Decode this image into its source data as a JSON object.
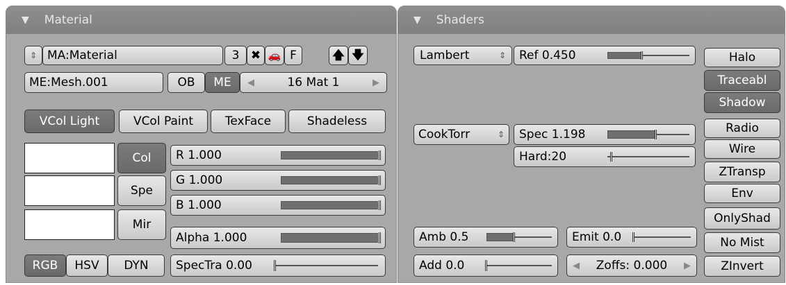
{
  "material_panel": {
    "title": "Material",
    "material_name": "MA:Material",
    "user_count": "3",
    "f_label": "F",
    "mesh_name": "ME:Mesh.001",
    "ob_label": "OB",
    "me_label": "ME",
    "mat_index": "16 Mat 1",
    "toggles": [
      "VCol Light",
      "VCol Paint",
      "TexFace",
      "Shadeless"
    ],
    "color_buttons": [
      "Col",
      "Spe",
      "Mir"
    ],
    "sliders": [
      {
        "label": "R 1.000",
        "value": 1.0
      },
      {
        "label": "G 1.000",
        "value": 1.0
      },
      {
        "label": "B 1.000",
        "value": 1.0
      },
      {
        "label": "Alpha 1.000",
        "value": 1.0
      },
      {
        "label": "SpecTra 0.00",
        "value": 0.0
      }
    ],
    "modes": [
      "RGB",
      "HSV",
      "DYN"
    ]
  },
  "shaders_panel": {
    "title": "Shaders",
    "diffuse_shader": "Lambert",
    "specular_shader": "CookTorr",
    "ref": {
      "label": "Ref  0.450",
      "value": 0.45
    },
    "spec": {
      "label": "Spec 1.198",
      "value": 0.6
    },
    "hard": {
      "label": "Hard:20",
      "value": 0.04
    },
    "amb": {
      "label": "Amb 0.5",
      "value": 0.5
    },
    "emit": {
      "label": "Emit 0.0",
      "value": 0.0
    },
    "add": {
      "label": "Add 0.0",
      "value": 0.0
    },
    "zoffs": "Zoffs: 0.000",
    "buttons": [
      "Halo",
      "Traceabl",
      "Shadow",
      "Radio",
      "Wire",
      "ZTransp",
      "Env",
      "OnlyShad",
      "No Mist",
      "ZInvert"
    ]
  }
}
